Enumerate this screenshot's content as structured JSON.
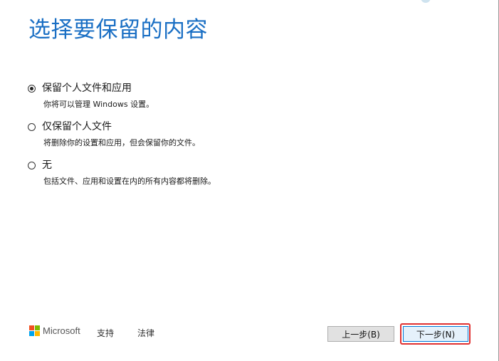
{
  "page": {
    "title": "选择要保留的内容"
  },
  "options": [
    {
      "label": "保留个人文件和应用",
      "description": "你将可以管理 Windows 设置。",
      "checked": true
    },
    {
      "label": "仅保留个人文件",
      "description": "将删除你的设置和应用，但会保留你的文件。",
      "checked": false
    },
    {
      "label": "无",
      "description": "包括文件、应用和设置在内的所有内容都将删除。",
      "checked": false
    }
  ],
  "footer": {
    "brand": "Microsoft",
    "support_link": "支持",
    "legal_link": "法律",
    "back_button": "上一步(B)",
    "next_button": "下一步(N)"
  },
  "colors": {
    "title_blue": "#1a6fc4",
    "highlight_red": "#e03030",
    "ms_red": "#f25022",
    "ms_green": "#7fba00",
    "ms_blue": "#00a4ef",
    "ms_yellow": "#ffb900"
  }
}
